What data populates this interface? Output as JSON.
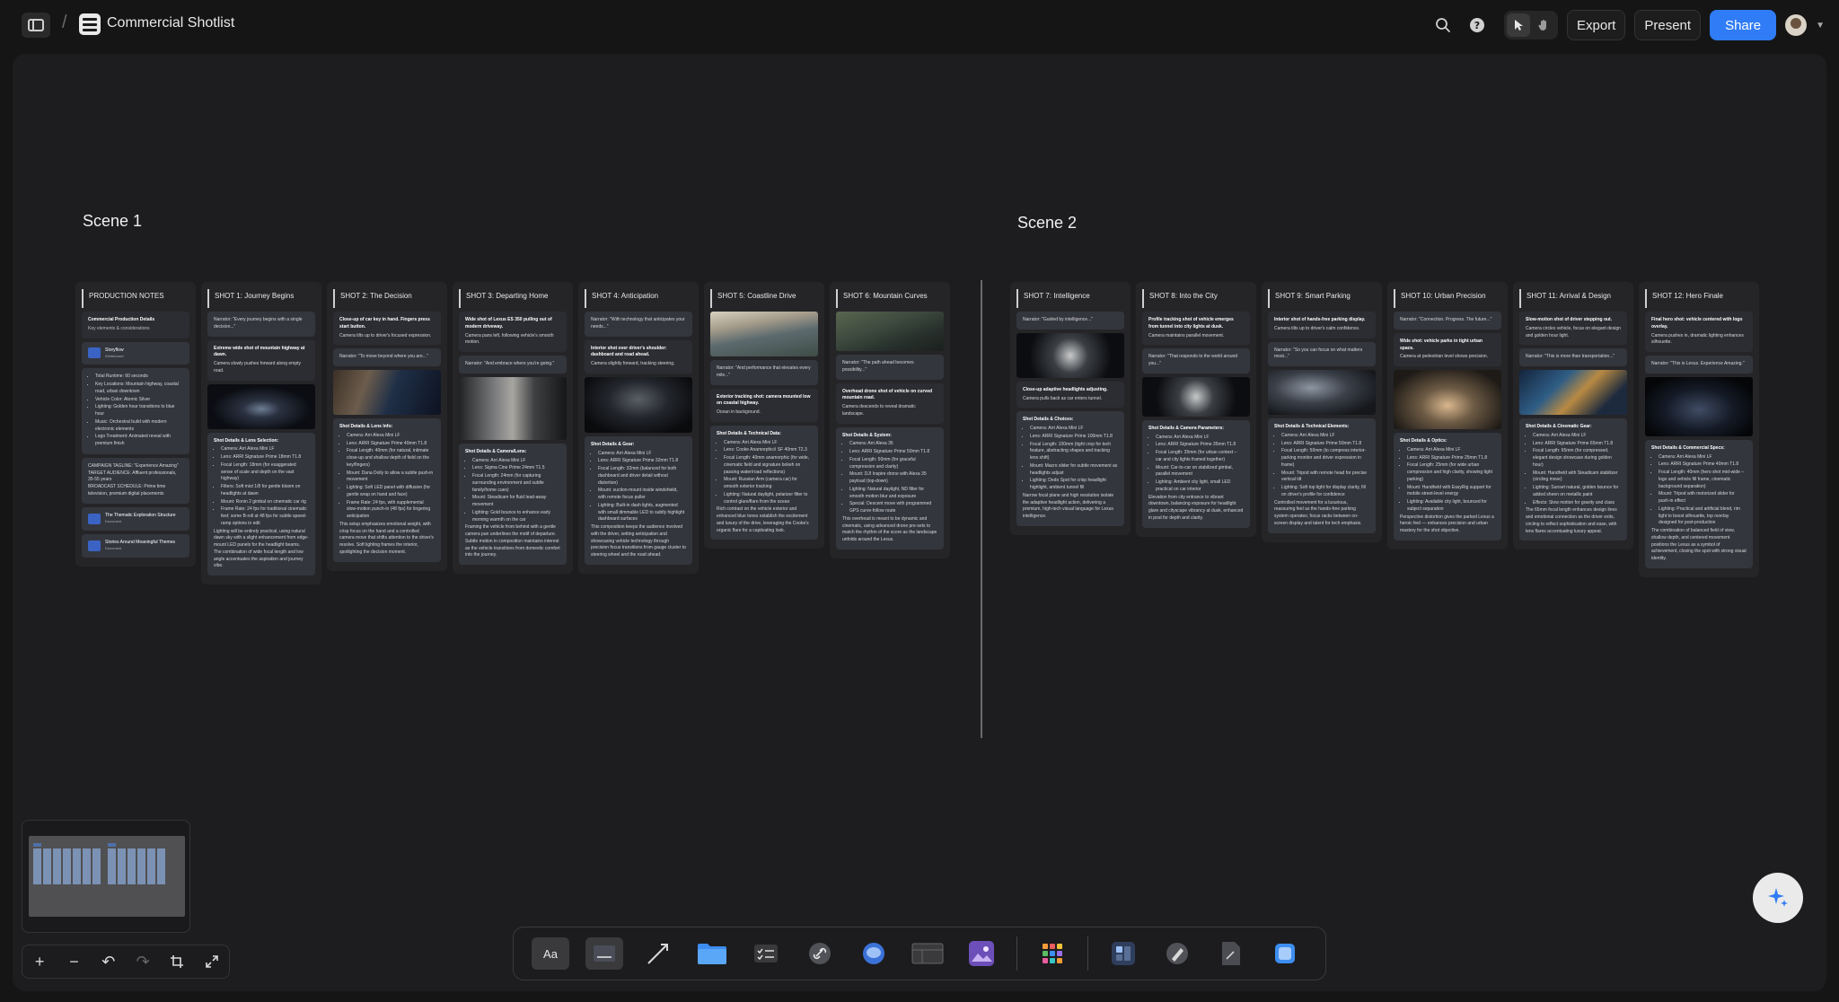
{
  "header": {
    "board_title": "Commercial Shotlist",
    "export_label": "Export",
    "present_label": "Present",
    "share_label": "Share",
    "icons": [
      "sidebar-toggle-icon",
      "board-icon",
      "search-icon",
      "help-icon",
      "pointer-icon",
      "hand-icon",
      "avatar"
    ]
  },
  "canvas": {
    "scene1_title": "Scene 1",
    "scene2_title": "Scene 2",
    "notes": {
      "title": "PRODUCTION NOTES",
      "details_h": "Commercial Production Details",
      "details_sub": "Key elements & considerations",
      "storyflow_title": "Storyflow",
      "storyflow_sub": "Whiteboard",
      "bullets": [
        "Total Runtime: 60 seconds",
        "Key Locations: Mountain highway, coastal road, urban downtown",
        "Vehicle Color: Atomic Silver",
        "Lighting: Golden hour transitions to blue hour",
        "Music: Orchestral build with modern electronic elements",
        "Logo Treatment: Animated reveal with premium finish"
      ],
      "campaign": [
        "CAMPAIGN TAGLINE: \"Experience Amazing\"",
        "TARGET AUDIENCE: Affluent professionals, 35-55 years",
        "BROADCAST SCHEDULE: Prime time television, premium digital placements"
      ],
      "link1_title": "The Thematic Exploration Structure",
      "link1_sub": "Document",
      "link2_title": "Stories Around Meaningful Themes",
      "link2_sub": "Document"
    },
    "shots": [
      {
        "title": "SHOT 1: Journey Begins",
        "narrator": "Narrator: \"Every journey begins with a single decision...\"",
        "desc_h": "Extreme wide shot of mountain highway at dawn.",
        "desc": "Camera slowly pushes forward along empty road.",
        "details_h": "Shot Details & Lens Selection:",
        "bullets": [
          "Camera: Arri Alexa Mini LF",
          "Lens: ARRI Signature Prime 18mm T1.8",
          "Focal Length: 18mm (for exaggerated sense of scale and depth on the vast highway)",
          "Filters: Soft mist 1/8 for gentle bloom on headlights at dawn",
          "Mount: Ronin 2 gimbal on cinematic car rig",
          "Frame Rate: 24 fps for traditional cinematic feel; some B-roll at 48 fps for subtle speed-ramp options in edit"
        ],
        "note": "Lighting will be entirely practical, using natural dawn sky with a slight enhancement from edge-mount LED panels for the headlight beams. The combination of wide focal length and low angle accentuates the aspiration and journey vibe."
      },
      {
        "title": "SHOT 2: The Decision",
        "desc_h": "Close-up of car key in hand. Fingers press start button.",
        "desc": "Camera tilts up to driver's focused expression.",
        "narrator": "Narrator: \"To move beyond where you are...\"",
        "details_h": "Shot Details & Lens Info:",
        "bullets": [
          "Camera: Arri Alexa Mini LF",
          "Lens: ARRI Signature Prime 40mm T1.8",
          "Focal Length: 40mm (for natural, intimate close-up and shallow depth of field on the key/fingers)",
          "Mount: Dana Dolly to allow a subtle push-in movement",
          "Lighting: Soft LED panel with diffusion (for gentle wrap on hand and face)",
          "Frame Rate: 24 fps, with supplemental slow-motion punch-in (48 fps) for lingering anticipation"
        ],
        "note": "This setup emphasizes emotional weight, with crisp focus on the hand and a controlled camera move that shifts attention to the driver's resolve. Soft lighting frames the interior, spotlighting the decision moment."
      },
      {
        "title": "SHOT 3: Departing Home",
        "desc_h": "Wide shot of Lexus ES 350 pulling out of modern driveway.",
        "desc": "Camera pans left, following vehicle's smooth motion.",
        "narrator": "Narrator: \"And embrace where you're going.\"",
        "details_h": "Shot Details & Camera/Lens:",
        "bullets": [
          "Camera: Arri Alexa Mini LF",
          "Lens: Sigma Cine Prime 24mm T1.5",
          "Focal Length: 24mm (for capturing surrounding environment and subtle family/home cues)",
          "Mount: Steadicam for fluid lead-away movement",
          "Lighting: Gold bounce to enhance early morning warmth on the car"
        ],
        "note": "Framing the vehicle from behind with a gentle camera pan underlines the motif of departure. Subtle motion in composition maintains interest as the vehicle transitions from domestic comfort into the journey."
      },
      {
        "title": "SHOT 4: Anticipation",
        "narrator": "Narrator: \"With technology that anticipates your needs...\"",
        "desc_h": "Interior shot over driver's shoulder: dashboard and road ahead.",
        "desc": "Camera slightly forward, tracking steering.",
        "details_h": "Shot Details & Gear:",
        "bullets": [
          "Camera: Arri Alexa Mini LF",
          "Lens: ARRI Signature Prime 32mm T1.8",
          "Focal Length: 32mm (balanced for both dashboard and driver detail without distortion)",
          "Mount: suction-mount inside windshield, with remote focus puller",
          "Lighting: Built-in dash lights, augmented with small dimmable LED to subtly highlight dashboard surfaces"
        ],
        "note": "This composition keeps the audience involved with the driver, setting anticipation and showcasing vehicle technology through precision focus transitions from gauge cluster to steering wheel and the road ahead."
      },
      {
        "title": "SHOT 5: Coastline Drive",
        "narrator": "Narrator: \"And performance that elevates every mile...\"",
        "desc_h": "Exterior tracking shot: camera mounted low on coastal highway.",
        "desc": "Ocean in background.",
        "details_h": "Shot Details & Technical Data:",
        "bullets": [
          "Camera: Arri Alexa Mini LF",
          "Lens: Cooke Anamorphic/i SF 40mm T2.3",
          "Focal Length: 40mm anamorphic (for wide, cinematic field and signature bokeh on passing water/road reflections)",
          "Mount: Russian Arm (camera car) for smooth exterior tracking",
          "Lighting: Natural daylight, polarizer filter to control glare/flare from the ocean"
        ],
        "note": "Rich contrast on the vehicle exterior and enhanced blue tones establish the excitement and luxury of the drive, leveraging the Cooke's organic flare for a captivating look."
      },
      {
        "title": "SHOT 6: Mountain Curves",
        "narrator": "Narrator: \"The path ahead becomes possibility...\"",
        "desc_h": "Overhead drone shot of vehicle on curved mountain road.",
        "desc": "Camera descends to reveal dramatic landscape.",
        "details_h": "Shot Details & System:",
        "bullets": [
          "Camera: Arri Alexa 35",
          "Lens: ARRI Signature Prime 50mm T1.8",
          "Focal Length: 50mm (for graceful compression and clarity)",
          "Mount: DJI Inspire drone with Alexa 35 payload (top-down)",
          "Lighting: Natural daylight, ND filter for smooth motion blur and exposure",
          "Special: Descent move with programmed GPS curve-follow route"
        ],
        "note": "This overhead is meant to be dynamic and cinematic, using advanced drone pre-sets to match the rhythm of the score as the landscape unfolds around the Lexus."
      },
      {
        "title": "SHOT 7: Intelligence",
        "narrator": "Narrator: \"Guided by intelligence...\"",
        "desc_h": "Close-up adaptive headlights adjusting.",
        "desc": "Camera pulls back as car enters tunnel.",
        "details_h": "Shot Details & Choices:",
        "bullets": [
          "Camera: Arri Alexa Mini LF",
          "Lens: ARRI Signature Prime 100mm T1.8",
          "Focal Length: 100mm (tight crop for tech feature, abstracting shapes and tracking lens shift)",
          "Mount: Macro slider for subtle movement as headlights adjust",
          "Lighting: Dedo Spot for crisp headlight highlight, ambient tunnel fill"
        ],
        "note": "Narrow focal plane and high resolution isolate the adaptive headlight action, delivering a premium, high-tech visual language for Lexus intelligence."
      },
      {
        "title": "SHOT 8: Into the City",
        "desc_h": "Profile tracking shot of vehicle emerges from tunnel into city lights at dusk.",
        "desc": "Camera maintains parallel movement.",
        "narrator": "Narrator: \"That responds to the world around you...\"",
        "details_h": "Shot Details & Camera Parameters:",
        "bullets": [
          "Camera: Arri Alexa Mini LF",
          "Lens: ARRI Signature Prime 35mm T1.8",
          "Focal Length: 35mm (for urban context – car and city lights framed together)",
          "Mount: Car-to-car on stabilized gimbal, parallel movement",
          "Lighting: Ambient city light, small LED practical on car interior"
        ],
        "note": "Elevation from city entrance to vibrant downtown, balancing exposure for headlight glare and cityscape vibrancy at dusk, enhanced in post for depth and clarity."
      },
      {
        "title": "SHOT 9: Smart Parking",
        "desc_h": "Interior shot of hands-free parking display.",
        "desc": "Camera tilts up to driver's calm confidence.",
        "narrator": "Narrator: \"So you can focus on what matters most...\"",
        "details_h": "Shot Details & Technical Elements:",
        "bullets": [
          "Camera: Arri Alexa Mini LF",
          "Lens: ARRI Signature Prime 50mm T1.8",
          "Focal Length: 50mm (to compress interior-parking monitor and driver expression in frame)",
          "Mount: Tripod with remote head for precise vertical tilt",
          "Lighting: Soft top light for display clarity, fill on driver's profile for confidence"
        ],
        "note": "Controlled movement for a luxurious, reassuring feel as the hands-free parking system operates; focus racks between on-screen display and talent for tech emphasis."
      },
      {
        "title": "SHOT 10: Urban Precision",
        "narrator": "Narrator: \"Connection. Progress. The future...\"",
        "desc_h": "Wide shot: vehicle parks in tight urban space.",
        "desc": "Camera at pedestrian level shows precision.",
        "details_h": "Shot Details & Optics:",
        "bullets": [
          "Camera: Arri Alexa Mini LF",
          "Lens: ARRI Signature Prime 25mm T1.8",
          "Focal Length: 25mm (for wide urban compression and high clarity, showing tight parking)",
          "Mount: Handheld with EasyRig support for mobile street-level energy",
          "Lighting: Available city light, bounced for subject separation"
        ],
        "note": "Perspective distortion gives the parked Lexus a heroic feel — enhances precision and urban mastery for the shot objective."
      },
      {
        "title": "SHOT 11: Arrival & Design",
        "desc_h": "Slow-motion shot of driver stepping out.",
        "desc": "Camera circles vehicle, focus on elegant design and golden hour light.",
        "narrator": "Narrator: \"This is more than transportation...\"",
        "details_h": "Shot Details & Cinematic Gear:",
        "bullets": [
          "Camera: Arri Alexa Mini LF",
          "Lens: ARRI Signature Prime 65mm T1.8",
          "Focal Length: 65mm (for compressed, elegant design showcase during golden hour)",
          "Mount: Handheld with Steadicam stabilizer (circling move)",
          "Lighting: Sunset natural, golden bounce for added sheen on metallic paint",
          "Effects: Slow motion for gravity and class"
        ],
        "note": "The 65mm focal length enhances design lines and emotional connection as the driver exits, circling to reflect sophistication and ease, with lens flares accentuating luxury appeal."
      },
      {
        "title": "SHOT 12: Hero Finale",
        "desc_h": "Final hero shot: vehicle centered with logo overlay.",
        "desc": "Camera pushes in, dramatic lighting enhances silhouette.",
        "narrator": "Narrator: \"This is Lexus. Experience Amazing.\"",
        "details_h": "Shot Details & Commercial Specs:",
        "bullets": [
          "Camera: Arri Alexa Mini LF",
          "Lens: ARRI Signature Prime 40mm T1.8",
          "Focal Length: 40mm (hero shot mid-wide – logo and vehicle fill frame, cinematic background separation)",
          "Mount: Tripod with motorized slider for push-in effect",
          "Lighting: Practical and artificial blend, rim light to boost silhouette, top overlay designed for post-production"
        ],
        "note": "The combination of balanced field of view, shallow depth, and centered movement positions the Lexus as a symbol of achievement, closing the spot with strong visual identity."
      }
    ]
  },
  "toolbar": {
    "text_tool_label": "Aa",
    "tools": [
      "text-tool",
      "sticky-note-tool",
      "arrow-tool",
      "folder-tool",
      "checklist-tool",
      "link-tool",
      "comment-tool",
      "table-tool",
      "image-tool",
      "apps-tool",
      "template-tool",
      "draw-tool",
      "document-tool",
      "ai-image-tool"
    ]
  },
  "colors": {
    "accent": "#2f7cf6",
    "canvas_bg": "#1d1d1f",
    "card_bg": "#34363e",
    "column_bg": "#252528"
  }
}
